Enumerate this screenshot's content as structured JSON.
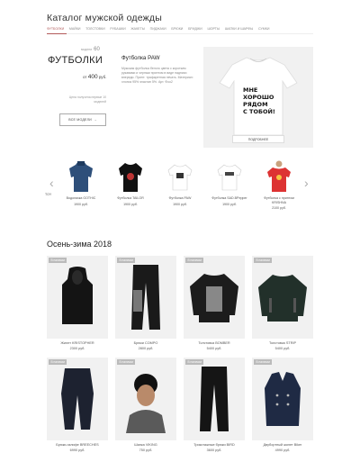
{
  "header": {
    "title": "Каталог мужской одежды"
  },
  "nav": {
    "items": [
      {
        "label": "футболки",
        "active": true
      },
      {
        "label": "майки",
        "active": false
      },
      {
        "label": "толстовки",
        "active": false
      },
      {
        "label": "рубашки",
        "active": false
      },
      {
        "label": "жакеты",
        "active": false
      },
      {
        "label": "пиджаки",
        "active": false
      },
      {
        "label": "брюки",
        "active": false
      },
      {
        "label": "бриджи",
        "active": false
      },
      {
        "label": "шорты",
        "active": false
      },
      {
        "label": "шапки и шарфы",
        "active": false
      },
      {
        "label": "сумки",
        "active": false
      }
    ]
  },
  "category": {
    "code_label": "модели",
    "count": "60",
    "title": "ФУТБОЛКИ",
    "price_prefix": "от",
    "price_value": "400",
    "price_unit": "руб.",
    "note": "Цена получена первые 10 моделей",
    "all_models_label": "ВСЕ МОДЕЛИ"
  },
  "featured": {
    "name": "Футболка PAW",
    "description": "Мужская футболка белого цвета с коротким рукавами и черным принтом в виде надписи впереди. Принт: трафаретная печать. Материал: хлопок 95% эластан 5%. Арт. Фоо2",
    "shirt_text_lines": [
      "МНЕ",
      "ХОРОШО",
      "РЯДОМ",
      "С ТОБОЙ!"
    ],
    "button_label": "ПОДРОБНЕЕ"
  },
  "carousel": {
    "left_edge_label": "TOY",
    "items": [
      {
        "name": "Водолазка GOTHIC",
        "price": "1900 руб."
      },
      {
        "name": "Футболка TAILOR",
        "price": "1900 руб."
      },
      {
        "name": "Футболка PAW",
        "price": "1900 руб."
      },
      {
        "name": "Футболка SAD.BPepper",
        "price": "1900 руб."
      },
      {
        "name": "Футболка с принтом KRISHNA",
        "price": "2100 руб."
      }
    ]
  },
  "section": {
    "title": "Осень-зима 2018"
  },
  "products": [
    {
      "badge": "В наличии",
      "name": "Жилет KRISTOPHER",
      "price": "2300 руб."
    },
    {
      "badge": "В наличии",
      "name": "Брюки COMPO",
      "price": "2800 руб."
    },
    {
      "badge": "В наличии",
      "name": "Толстовка BOMBER",
      "price": "5400 руб."
    },
    {
      "badge": "В наличии",
      "name": "Толстовка STRIP",
      "price": "5400 руб."
    },
    {
      "badge": "В наличии",
      "name": "Брюки-галифе BREECHES",
      "price": "6990 руб."
    },
    {
      "badge": "В наличии",
      "name": "Шапка VIKING",
      "price": "750 руб."
    },
    {
      "badge": "В наличии",
      "name": "Трикотажные брюки BIRD",
      "price": "3600 руб."
    },
    {
      "badge": "В наличии",
      "name": "Двубортный жилет Biker",
      "price": "4990 руб."
    }
  ]
}
